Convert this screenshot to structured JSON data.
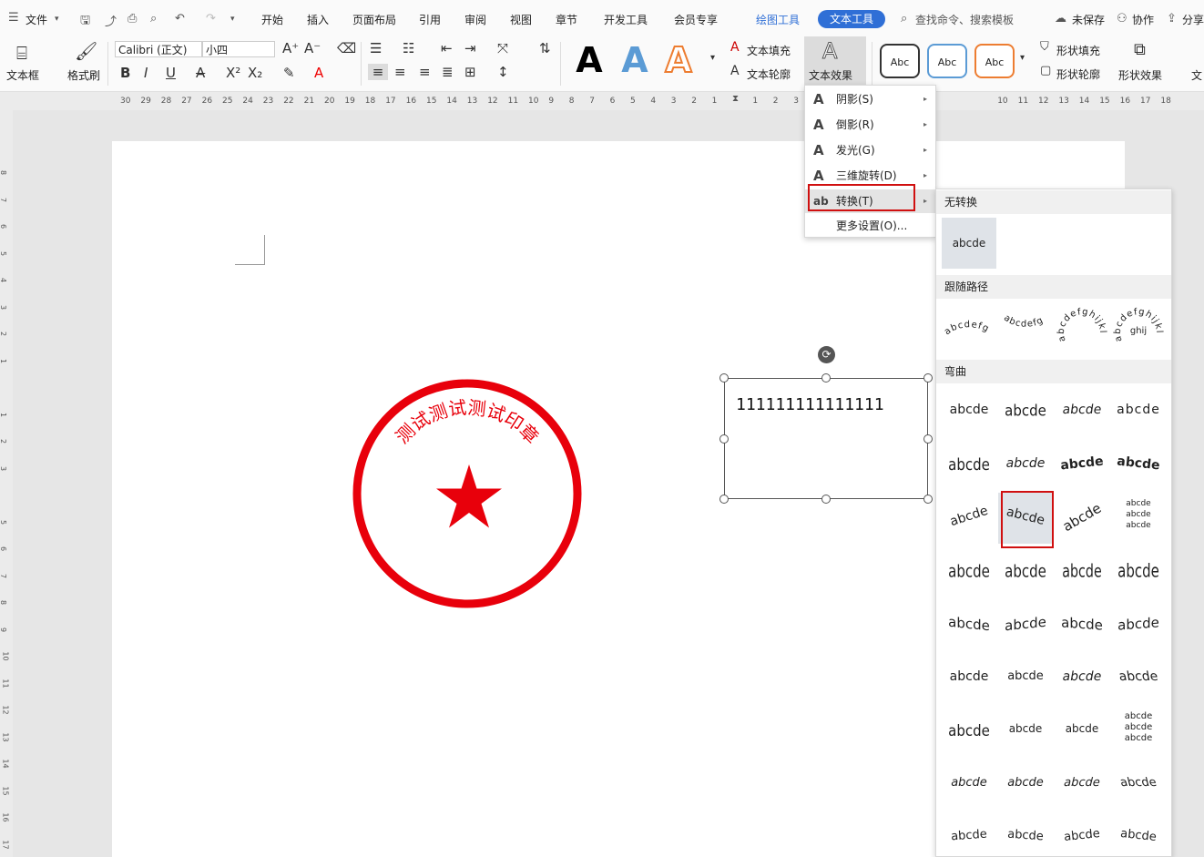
{
  "menubar": {
    "file": "文件",
    "tabs": [
      "开始",
      "插入",
      "页面布局",
      "引用",
      "审阅",
      "视图",
      "章节",
      "开发工具",
      "会员专享"
    ],
    "drawing_tool": "绘图工具",
    "text_tool": "文本工具",
    "search": "查找命令、搜索模板",
    "unsaved": "未保存",
    "collab": "协作",
    "share": "分享"
  },
  "ribbon": {
    "textbox": "文本框",
    "format_painter": "格式刷",
    "font_name": "Calibri (正文)",
    "font_size": "小四",
    "text_fill": "文本填充",
    "text_outline": "文本轮廓",
    "text_effects": "文本效果",
    "style_abc": "Abc",
    "shape_fill": "形状填充",
    "shape_outline": "形状轮廓",
    "shape_effects": "形状效果",
    "wrap_cut": "文"
  },
  "ruler": {
    "h": [
      "30",
      "29",
      "28",
      "27",
      "26",
      "25",
      "24",
      "23",
      "22",
      "21",
      "20",
      "19",
      "18",
      "17",
      "16",
      "15",
      "14",
      "13",
      "12",
      "11",
      "10",
      "9",
      "8",
      "7",
      "6",
      "5",
      "4",
      "3",
      "2",
      "1",
      "",
      "1",
      "2",
      "3",
      "",
      "",
      "",
      "",
      "",
      "",
      "",
      "",
      "",
      "10",
      "11",
      "12",
      "13",
      "14",
      "15",
      "16",
      "17",
      "18"
    ],
    "v": [
      "8",
      "7",
      "6",
      "5",
      "4",
      "3",
      "2",
      "1",
      "",
      "1",
      "2",
      "3",
      "",
      "5",
      "6",
      "7",
      "8",
      "9",
      "10",
      "11",
      "12",
      "13",
      "14",
      "15",
      "16",
      "17"
    ]
  },
  "document": {
    "seal_text": "测试测试测试印章",
    "textbox_text": "111111111111111"
  },
  "effects_menu": {
    "items": [
      {
        "icon": "A",
        "label": "阴影(S)"
      },
      {
        "icon": "A",
        "label": "倒影(R)"
      },
      {
        "icon": "A",
        "label": "发光(G)"
      },
      {
        "icon": "A",
        "label": "三维旋转(D)"
      },
      {
        "icon": "ab",
        "label": "转换(T)"
      },
      {
        "icon": "",
        "label": "更多设置(O)..."
      }
    ]
  },
  "transform_panel": {
    "no_transform": "无转换",
    "no_transform_sample": "abcde",
    "follow_path": "跟随路径",
    "follow_samples": [
      "abcdefg",
      "abcdefg",
      "abcdefghijkl",
      "abcdefghijkl"
    ],
    "warp": "弯曲",
    "warp_sample": "abcde"
  },
  "colors": {
    "accent": "#2f6fd6",
    "seal_red": "#e8000b",
    "highlight_red": "#d01010"
  }
}
